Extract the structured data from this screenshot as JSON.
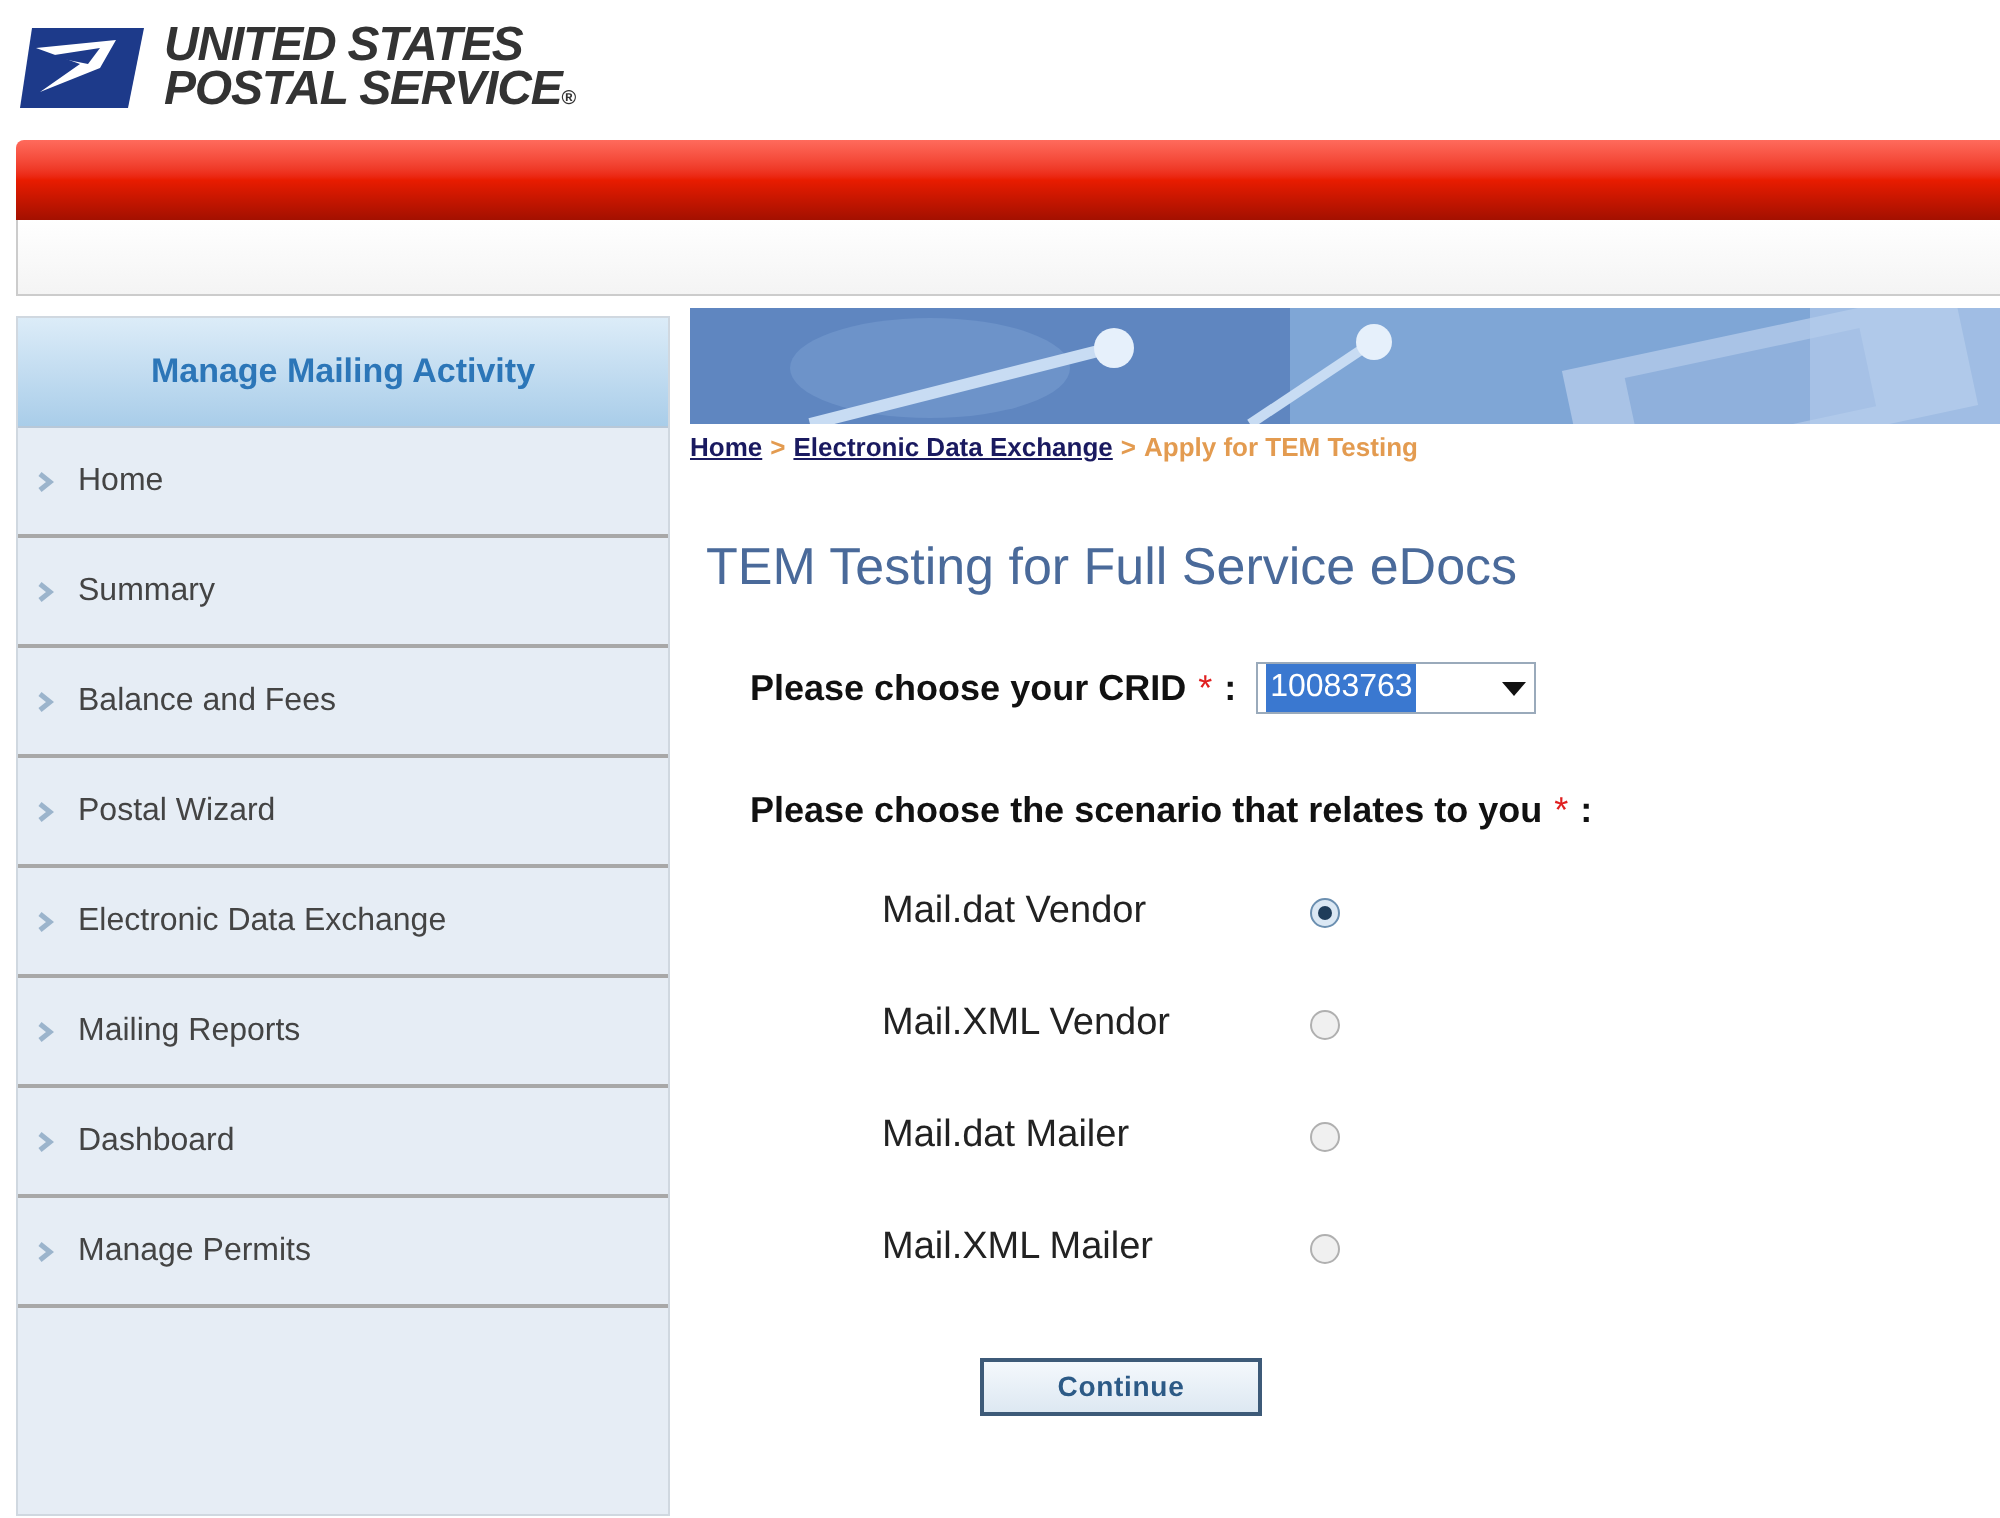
{
  "logo": {
    "line_1": "UNITED STATES",
    "line_2": "POSTAL SERVICE",
    "mark": "®"
  },
  "sidebar": {
    "title": "Manage Mailing Activity",
    "items": [
      {
        "label": "Home"
      },
      {
        "label": "Summary"
      },
      {
        "label": "Balance and Fees"
      },
      {
        "label": "Postal Wizard"
      },
      {
        "label": "Electronic Data Exchange"
      },
      {
        "label": "Mailing Reports"
      },
      {
        "label": "Dashboard"
      },
      {
        "label": "Manage Permits"
      }
    ]
  },
  "breadcrumb": {
    "separator": ">",
    "items": [
      {
        "label": "Home",
        "kind": "link"
      },
      {
        "label": "Electronic Data Exchange",
        "kind": "link"
      },
      {
        "label": "Apply for TEM Testing",
        "kind": "current"
      }
    ]
  },
  "title": "TEM Testing for Full Service eDocs",
  "crid": {
    "label": "Please choose your CRID",
    "required_mark": "*",
    "colon": ":",
    "value": "10083763"
  },
  "scenario": {
    "label": "Please choose the scenario that relates to you",
    "required_mark": "*",
    "colon": ":",
    "options": [
      {
        "label": "Mail.dat Vendor",
        "selected": true
      },
      {
        "label": "Mail.XML Vendor",
        "selected": false
      },
      {
        "label": "Mail.dat Mailer",
        "selected": false
      },
      {
        "label": "Mail.XML Mailer",
        "selected": false
      }
    ]
  },
  "continue_button": "Continue"
}
